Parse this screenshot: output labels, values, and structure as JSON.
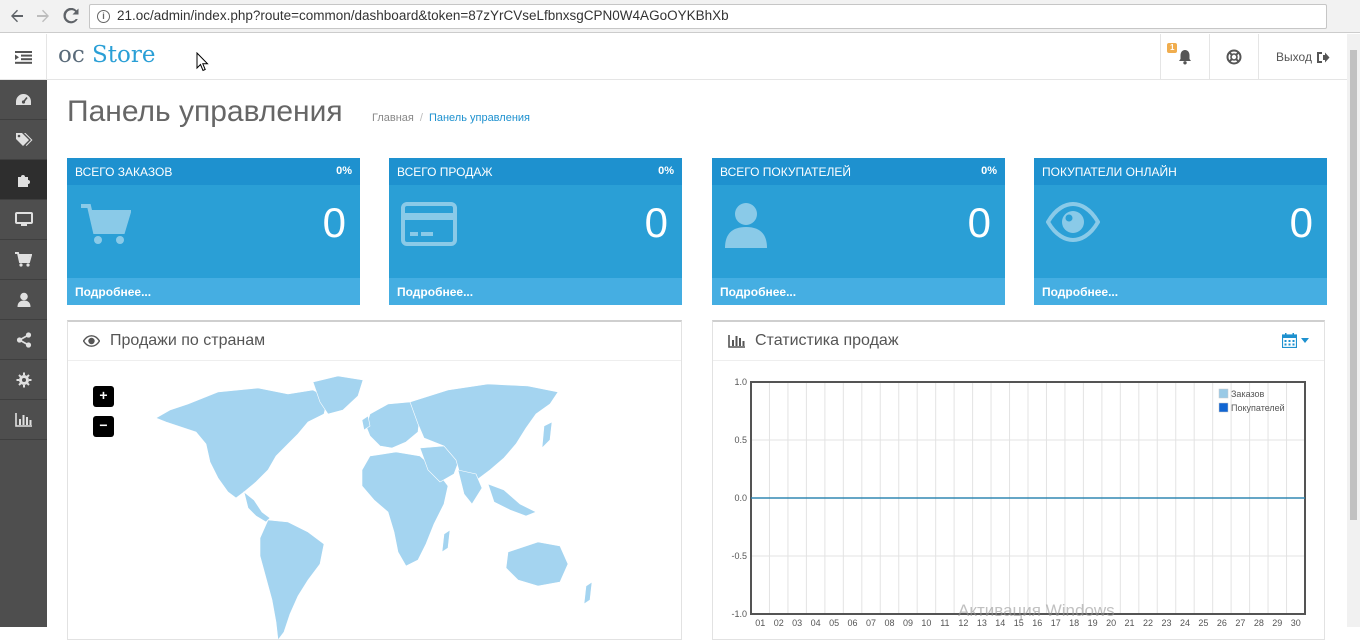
{
  "browser": {
    "url": "21.oc/admin/index.php?route=common/dashboard&token=87zYrCVseLfbnxsgCPN0W4AGoOYKBhXb"
  },
  "header": {
    "logo_prefix": "oc",
    "logo_name": "Store",
    "notifications_badge": "1",
    "logout_label": "Выход"
  },
  "sidebar": {
    "items": [
      {
        "icon": "dashboard-icon"
      },
      {
        "icon": "tags-icon"
      },
      {
        "icon": "puzzle-icon",
        "active": true
      },
      {
        "icon": "desktop-icon"
      },
      {
        "icon": "cart-icon"
      },
      {
        "icon": "user-icon"
      },
      {
        "icon": "share-icon"
      },
      {
        "icon": "cog-icon"
      },
      {
        "icon": "bar-chart-icon"
      }
    ]
  },
  "page": {
    "title": "Панель управления",
    "breadcrumb": {
      "home": "Главная",
      "current": "Панель управления"
    }
  },
  "tiles": [
    {
      "title": "ВСЕГО ЗАКАЗОВ",
      "percent": "0%",
      "value": "0",
      "footer": "Подробнее...",
      "icon": "shopping-cart-icon"
    },
    {
      "title": "ВСЕГО ПРОДАЖ",
      "percent": "0%",
      "value": "0",
      "footer": "Подробнее...",
      "icon": "credit-card-icon"
    },
    {
      "title": "ВСЕГО ПОКУПАТЕЛЕЙ",
      "percent": "0%",
      "value": "0",
      "footer": "Подробнее...",
      "icon": "user-icon"
    },
    {
      "title": "ПОКУПАТЕЛИ ОНЛАЙН",
      "percent": "",
      "value": "0",
      "footer": "Подробнее...",
      "icon": "eye-icon"
    }
  ],
  "map_panel": {
    "title": "Продажи по странам",
    "zoom_in": "+",
    "zoom_out": "−"
  },
  "chart_panel": {
    "title": "Статистика продаж"
  },
  "chart_data": {
    "type": "line",
    "title": "",
    "xlabel": "",
    "ylabel": "",
    "x": [
      "01",
      "02",
      "03",
      "04",
      "05",
      "06",
      "07",
      "08",
      "09",
      "10",
      "11",
      "12",
      "13",
      "14",
      "15",
      "16",
      "17",
      "18",
      "19",
      "20",
      "21",
      "22",
      "23",
      "24",
      "25",
      "26",
      "27",
      "28",
      "29",
      "30"
    ],
    "series": [
      {
        "name": "Заказов",
        "color": "#9acae6",
        "values": [
          0,
          0,
          0,
          0,
          0,
          0,
          0,
          0,
          0,
          0,
          0,
          0,
          0,
          0,
          0,
          0,
          0,
          0,
          0,
          0,
          0,
          0,
          0,
          0,
          0,
          0,
          0,
          0,
          0,
          0
        ]
      },
      {
        "name": "Покупателей",
        "color": "#1065d2",
        "values": [
          0,
          0,
          0,
          0,
          0,
          0,
          0,
          0,
          0,
          0,
          0,
          0,
          0,
          0,
          0,
          0,
          0,
          0,
          0,
          0,
          0,
          0,
          0,
          0,
          0,
          0,
          0,
          0,
          0,
          0
        ]
      }
    ],
    "ylim": [
      -1.0,
      1.0
    ],
    "yticks": [
      "1.0",
      "0.5",
      "0.0",
      "-0.5",
      "-1.0"
    ],
    "grid": true,
    "legend_position": "top-right"
  },
  "watermark": "Активация Windows",
  "colors": {
    "primary": "#2a9fd6",
    "primary_dark": "#1e91cf",
    "sidebar": "#4e4e4e"
  }
}
